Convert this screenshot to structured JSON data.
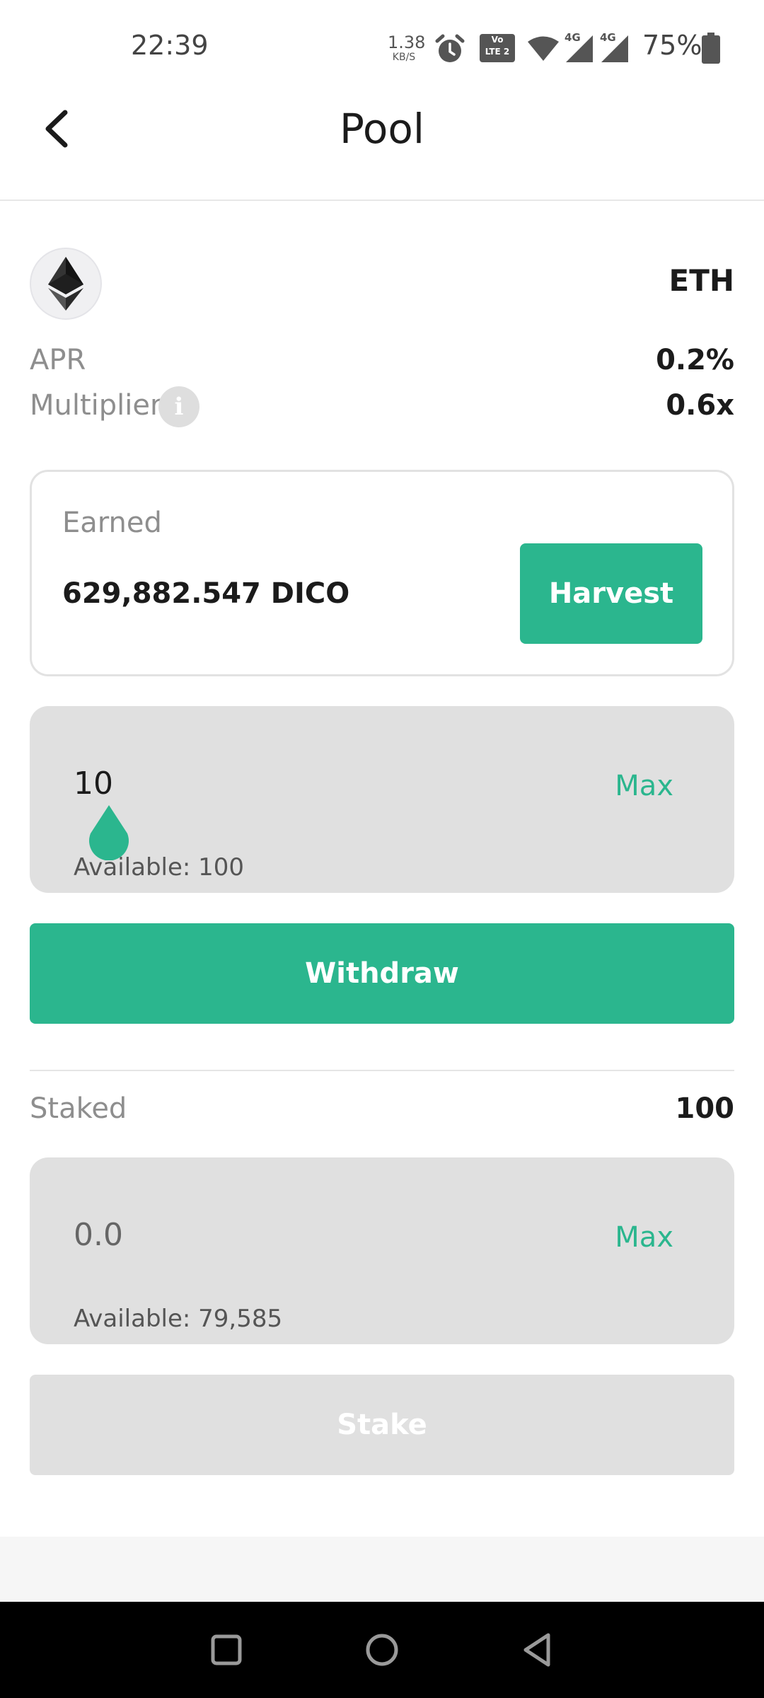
{
  "status_bar": {
    "time": "22:39",
    "net_speed_value": "1.38",
    "net_speed_unit": "KB/S",
    "volte_top": "Vo",
    "volte_bottom": "LTE 2",
    "network_1": "4G",
    "network_2": "4G",
    "battery": "75%",
    "icons": [
      "alarm-icon",
      "volte-icon",
      "wifi-icon",
      "signal-icon",
      "signal-icon",
      "battery-icon"
    ]
  },
  "header": {
    "title": "Pool",
    "back_icon": "chevron-left-icon"
  },
  "token": {
    "symbol": "ETH",
    "icon": "ethereum-icon"
  },
  "stats": {
    "apr_label": "APR",
    "apr_value": "0.2%",
    "multiplier_label": "Multiplier",
    "multiplier_info": "i",
    "multiplier_value": "0.6x"
  },
  "earned": {
    "label": "Earned",
    "value": "629,882.547 DICO",
    "harvest_label": "Harvest"
  },
  "withdraw_panel": {
    "amount": "10",
    "max_label": "Max",
    "available": "Available: 100",
    "button_label": "Withdraw"
  },
  "staked": {
    "label": "Staked",
    "value": "100"
  },
  "stake_panel": {
    "amount_placeholder": "0.0",
    "max_label": "Max",
    "available": "Available: 79,585",
    "button_label": "Stake"
  },
  "colors": {
    "accent": "#2bb68e",
    "panel": "#e0e0e0",
    "muted_text": "#8e8e8e"
  }
}
